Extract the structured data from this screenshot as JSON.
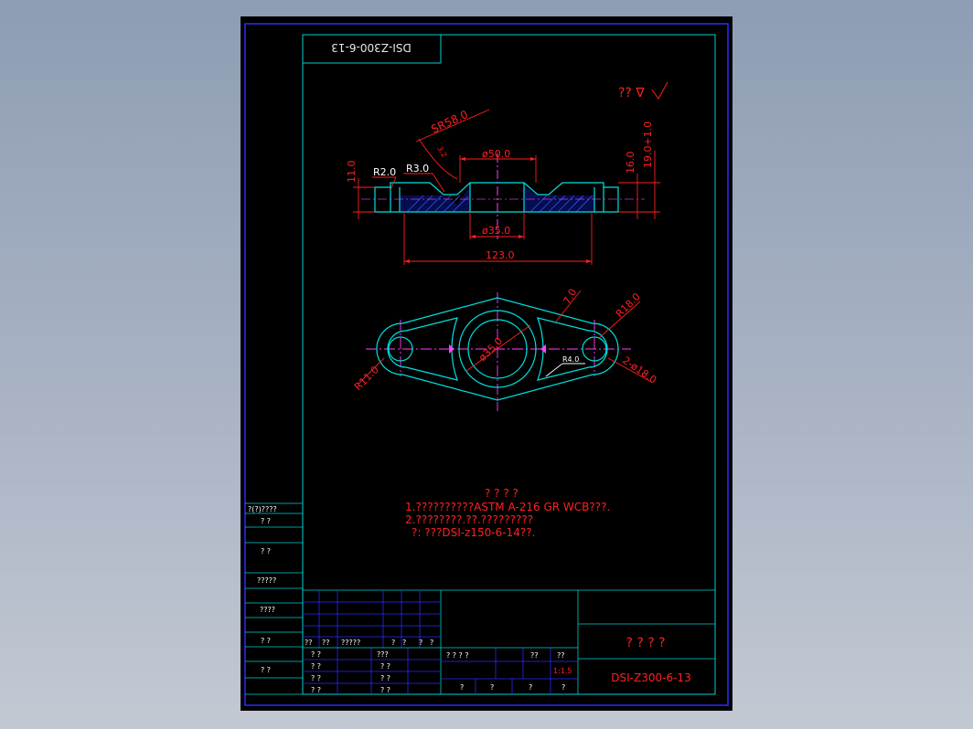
{
  "drawing": {
    "mirrored_code": "DSI-Z300-6-13",
    "roughness_note": "?? ∇",
    "dims": {
      "sr": "SR58.0",
      "top_dia": "ø50.0",
      "r2": "R2.0",
      "r3": "R3.0",
      "h11": "11.0",
      "h16": "16.0",
      "h19": "19.0+1.0",
      "bot_dia": "ø35.0",
      "len123": "123.0",
      "small32": "3.2",
      "seven": "7.0",
      "r18": "R18.0",
      "r11": "R11.0",
      "r4": "R4.0",
      "holes": "2-ø18.0",
      "center_dia": "ø35.0"
    },
    "notes": {
      "heading": "? ? ? ?",
      "line1": "1.??????????ASTM  A-216  GR  WCB???.",
      "line2": "2.????????.??.?????????",
      "line3": "?:  ???DSI-z150-6-14??."
    },
    "left_column": [
      "?(?)????",
      "?   ?",
      "?   ?",
      "?????",
      "????",
      "?   ?",
      "?   ?"
    ],
    "title_block": {
      "hdr_cells": [
        "??",
        "??",
        "?????",
        "?",
        "?",
        "?",
        "?"
      ],
      "sign_labels": [
        "? ?",
        "? ?",
        "? ?",
        "? ?"
      ],
      "sign_mid": [
        "???",
        "? ?",
        "? ?",
        "? ?"
      ],
      "info_labels": [
        "? ? ? ?",
        "??",
        "??"
      ],
      "scale": "1:1.5",
      "bottom_cells": [
        "?",
        "?",
        "?",
        "?"
      ],
      "part_name": "? ? ? ?",
      "drawing_no": "DSI-Z300-6-13"
    }
  }
}
